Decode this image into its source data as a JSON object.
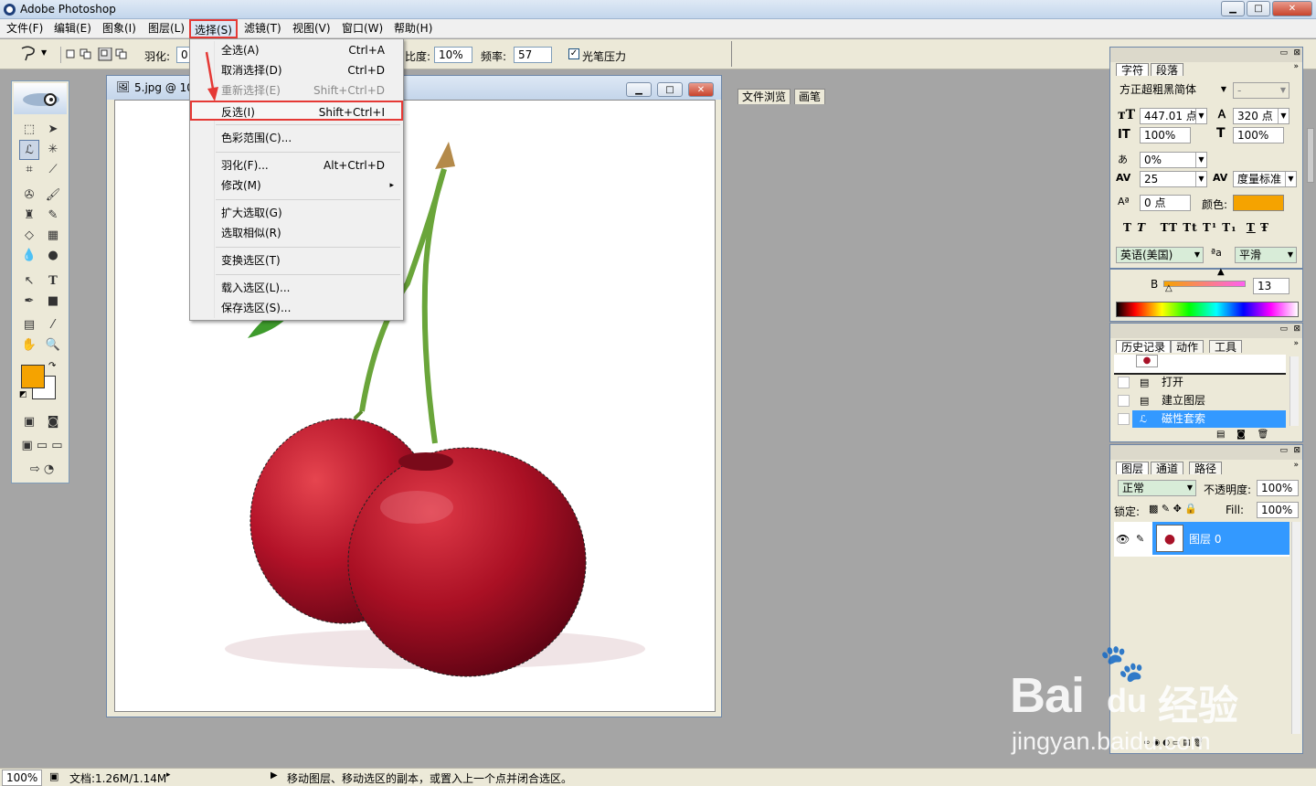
{
  "window": {
    "title": "Adobe Photoshop",
    "min_glyph": "▁",
    "max_glyph": "□",
    "close_glyph": "✕"
  },
  "menubar": {
    "items": [
      "文件(F)",
      "编辑(E)",
      "图象(I)",
      "图层(L)",
      "选择(S)",
      "滤镜(T)",
      "视图(V)",
      "窗口(W)",
      "帮助(H)"
    ]
  },
  "options_bar": {
    "feather_label": "羽化:",
    "feather_value": "0",
    "contrast_label": "比度:",
    "contrast_value": "10%",
    "frequency_label": "频率:",
    "frequency_value": "57",
    "pen_pressure_label": "光笔压力",
    "pen_pressure_checked": true,
    "tabs": [
      "文件浏览",
      "画笔"
    ]
  },
  "document": {
    "title": "5.jpg @ 10"
  },
  "select_menu": {
    "items": [
      {
        "label": "全选(A)",
        "shortcut": "Ctrl+A"
      },
      {
        "label": "取消选择(D)",
        "shortcut": "Ctrl+D"
      },
      {
        "label": "重新选择(E)",
        "shortcut": "Shift+Ctrl+D",
        "disabled": true
      },
      {
        "label": "反选(I)",
        "shortcut": "Shift+Ctrl+I",
        "highlighted": true
      },
      {
        "label": "色彩范围(C)..."
      },
      {
        "label": "羽化(F)...",
        "shortcut": "Alt+Ctrl+D"
      },
      {
        "label": "修改(M)",
        "submenu": "▸"
      },
      {
        "label": "扩大选取(G)"
      },
      {
        "label": "选取相似(R)"
      },
      {
        "label": "变换选区(T)"
      },
      {
        "label": "载入选区(L)..."
      },
      {
        "label": "保存选区(S)..."
      }
    ]
  },
  "char_panel": {
    "tabs": [
      "字符",
      "段落"
    ],
    "font_family": "方正超粗黑简体",
    "font_style": "-",
    "font_size": "447.01 点",
    "leading": "320 点",
    "vertical_scale": "100%",
    "horizontal_scale": "100%",
    "tsume": "0%",
    "tracking": "25",
    "kerning": "度量标准",
    "baseline_shift": "0 点",
    "color_label": "颜色:",
    "color": "#f5a300",
    "language": "英语(美国)",
    "aa_glyph": "ªa",
    "antialias": "平滑",
    "style_buttons": [
      "T",
      "T",
      "TT",
      "Tt",
      "T¹",
      "T₁",
      "T",
      "Ŧ"
    ]
  },
  "color_panel": {
    "channel": "B",
    "value": "13"
  },
  "history_panel": {
    "tabs": [
      "历史记录",
      "动作",
      "工具"
    ],
    "items": [
      {
        "label": "打开"
      },
      {
        "label": "建立图层"
      },
      {
        "label": "磁性套索",
        "selected": true
      }
    ]
  },
  "layers_panel": {
    "tabs": [
      "图层",
      "通道",
      "路径"
    ],
    "blend_mode": "正常",
    "opacity_label": "不透明度:",
    "opacity": "100%",
    "lock_label": "锁定:",
    "fill_label": "Fill:",
    "fill": "100%",
    "layers": [
      {
        "name": "图层 0"
      }
    ]
  },
  "status_bar": {
    "zoom": "100%",
    "doc_info": "文档:1.26M/1.14M",
    "hint": "移动图层、移动选区的副本，或置入上一个点并闭合选区。"
  },
  "watermark": {
    "brand": "Bai",
    "brand2": "du",
    "product": "经验",
    "url": "jingyan.baidu.com"
  },
  "colors": {
    "foreground": "#f5a300",
    "background": "#ffffff",
    "highlight": "#e53935",
    "selection": "#3399ff"
  },
  "icons": [
    "photoshop-logo-icon",
    "lasso-icon",
    "marquee-icon",
    "move-icon",
    "crop-icon",
    "brush-icon",
    "eraser-icon",
    "gradient-icon",
    "pen-icon",
    "type-icon",
    "hand-icon",
    "zoom-icon",
    "eyedropper-icon",
    "eye-icon"
  ]
}
